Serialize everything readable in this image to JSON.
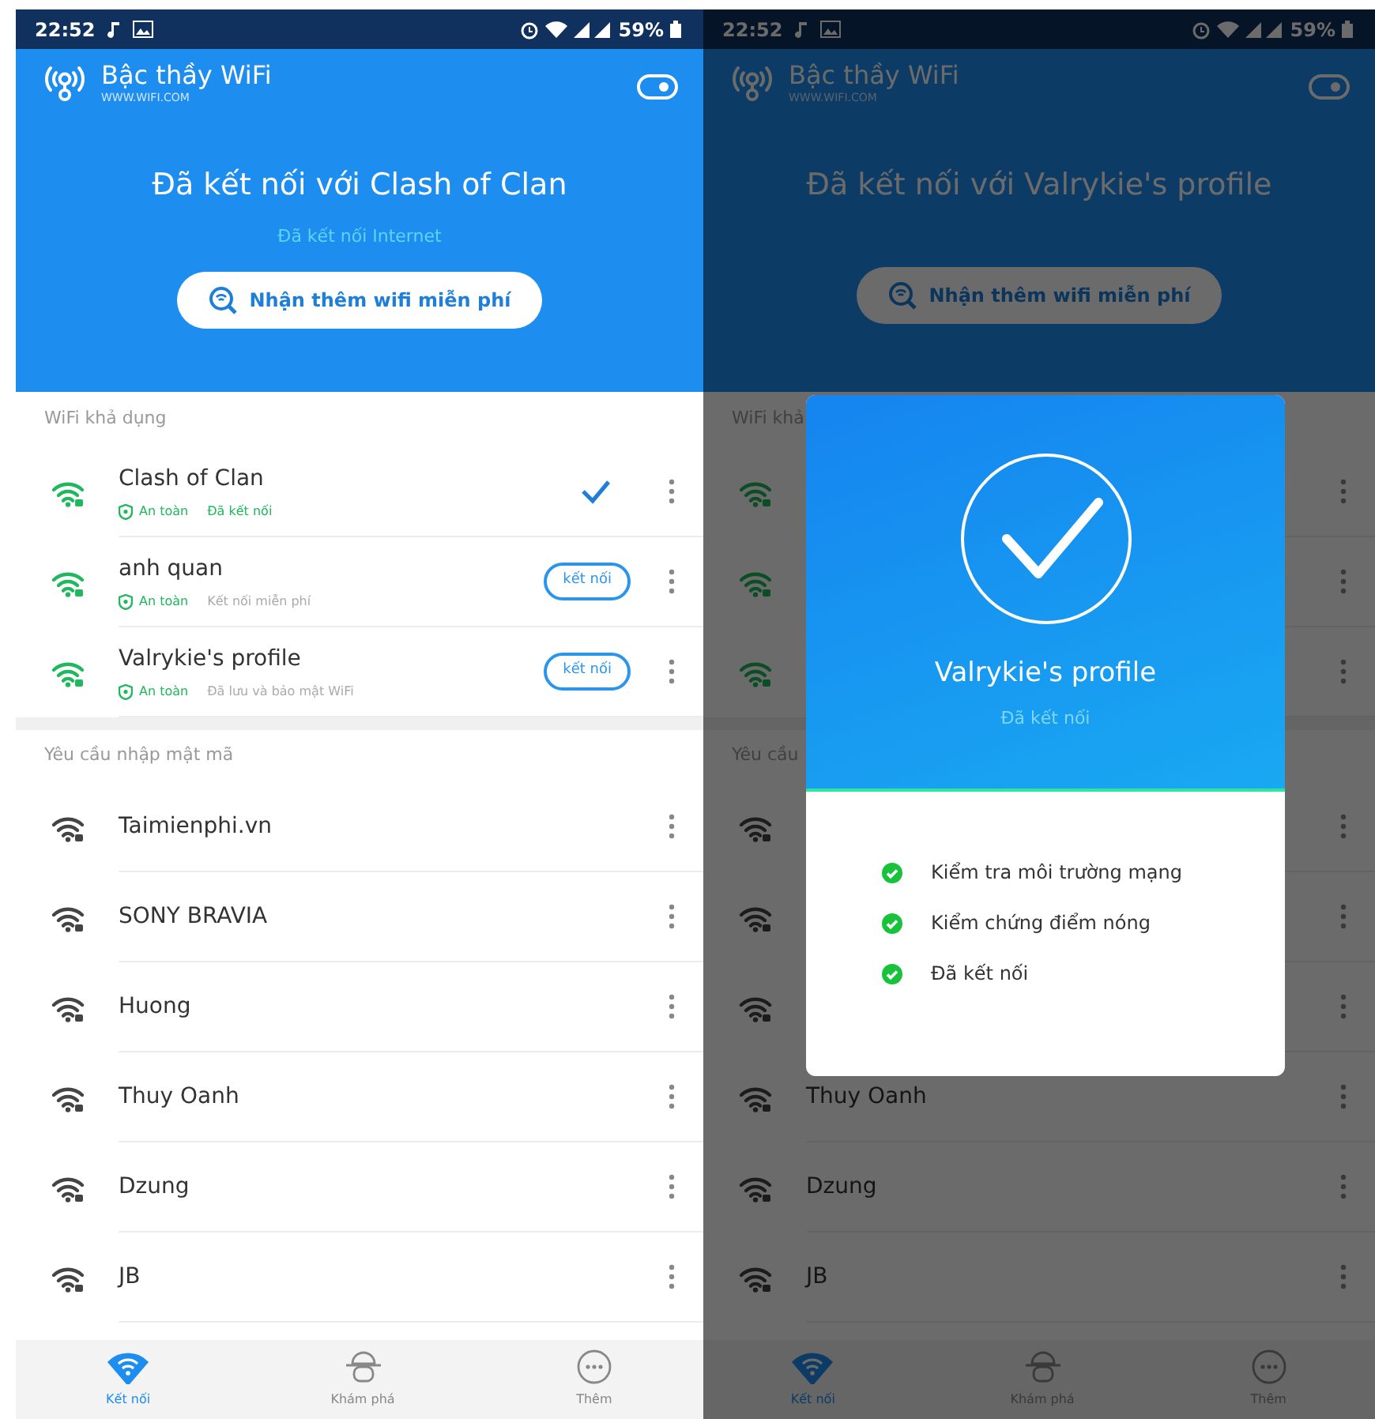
{
  "screens": [
    {
      "status_bar": {
        "time": "22:52",
        "battery": "59%"
      },
      "app": {
        "title": "Bậc thầy WiFi",
        "subtitle": "WWW.WIFI.COM",
        "toggle_on": true
      },
      "hero": {
        "title": "Đã kết nối với Clash of Clan",
        "subtitle": "Đã kết nối Internet",
        "button": "Nhận thêm wifi miễn phí"
      },
      "sections": [
        {
          "title": "WiFi khả dụng",
          "networks": [
            {
              "kind": "open",
              "name": "Clash of Clan",
              "connected": true,
              "tags": [
                {
                  "text": "An toàn",
                  "kind": "safe"
                },
                {
                  "text": "Đã kết nối",
                  "kind": "connected"
                }
              ]
            },
            {
              "kind": "open",
              "name": "anh quan",
              "connected": false,
              "button": "kết nối",
              "tags": [
                {
                  "text": "An toàn",
                  "kind": "safe"
                },
                {
                  "text": "Kết nối miễn phí",
                  "kind": "note"
                }
              ]
            },
            {
              "kind": "open",
              "name": "Valrykie's profile",
              "connected": false,
              "button": "kết nối",
              "tags": [
                {
                  "text": "An toàn",
                  "kind": "safe"
                },
                {
                  "text": "Đã lưu và bảo mật WiFi",
                  "kind": "note"
                }
              ]
            }
          ]
        },
        {
          "title": "Yêu cầu nhập mật mã",
          "networks": [
            {
              "kind": "locked",
              "name": "Taimienphi.vn"
            },
            {
              "kind": "locked",
              "name": "SONY BRAVIA"
            },
            {
              "kind": "locked",
              "name": "Huong"
            },
            {
              "kind": "locked",
              "name": "Thuy Oanh"
            },
            {
              "kind": "locked",
              "name": "Dzung"
            },
            {
              "kind": "locked",
              "name": "JB"
            }
          ]
        }
      ],
      "nav": [
        {
          "label": "Kết nối",
          "kind": "wifi",
          "selected": true
        },
        {
          "label": "Khám phá",
          "kind": "explore",
          "selected": false
        },
        {
          "label": "Thêm",
          "kind": "more",
          "selected": false
        }
      ]
    },
    {
      "dimmed": true,
      "status_bar": {
        "time": "22:52",
        "battery": "59%"
      },
      "app": {
        "title": "Bậc thầy WiFi",
        "subtitle": "WWW.WIFI.COM",
        "toggle_on": true
      },
      "hero": {
        "title": "Đã kết nối với Valrykie's profile",
        "button": "Nhận thêm wifi miễn phí"
      },
      "sections": [
        {
          "title": "WiFi khả",
          "networks": [
            {
              "kind": "open"
            },
            {
              "kind": "open"
            },
            {
              "kind": "open"
            }
          ]
        },
        {
          "title": "Yêu cầu",
          "networks": [
            {
              "kind": "locked"
            },
            {
              "kind": "locked"
            },
            {
              "kind": "locked"
            },
            {
              "kind": "locked",
              "name": "Thuy Oanh"
            },
            {
              "kind": "locked",
              "name": "Dzung"
            },
            {
              "kind": "locked",
              "name": "JB"
            }
          ]
        }
      ],
      "nav": [
        {
          "label": "Kết nối",
          "kind": "wifi",
          "selected": true
        },
        {
          "label": "Khám phá",
          "kind": "explore",
          "selected": false
        },
        {
          "label": "Thêm",
          "kind": "more",
          "selected": false
        }
      ],
      "dialog": {
        "title": "Valrykie's profile",
        "subtitle": "Đã kết nối",
        "steps": [
          {
            "text": "Kiểm tra môi trường mạng",
            "done": true
          },
          {
            "text": "Kiểm chứng điểm nóng",
            "done": true
          },
          {
            "text": "Đã kết nối",
            "done": true
          }
        ]
      }
    }
  ]
}
